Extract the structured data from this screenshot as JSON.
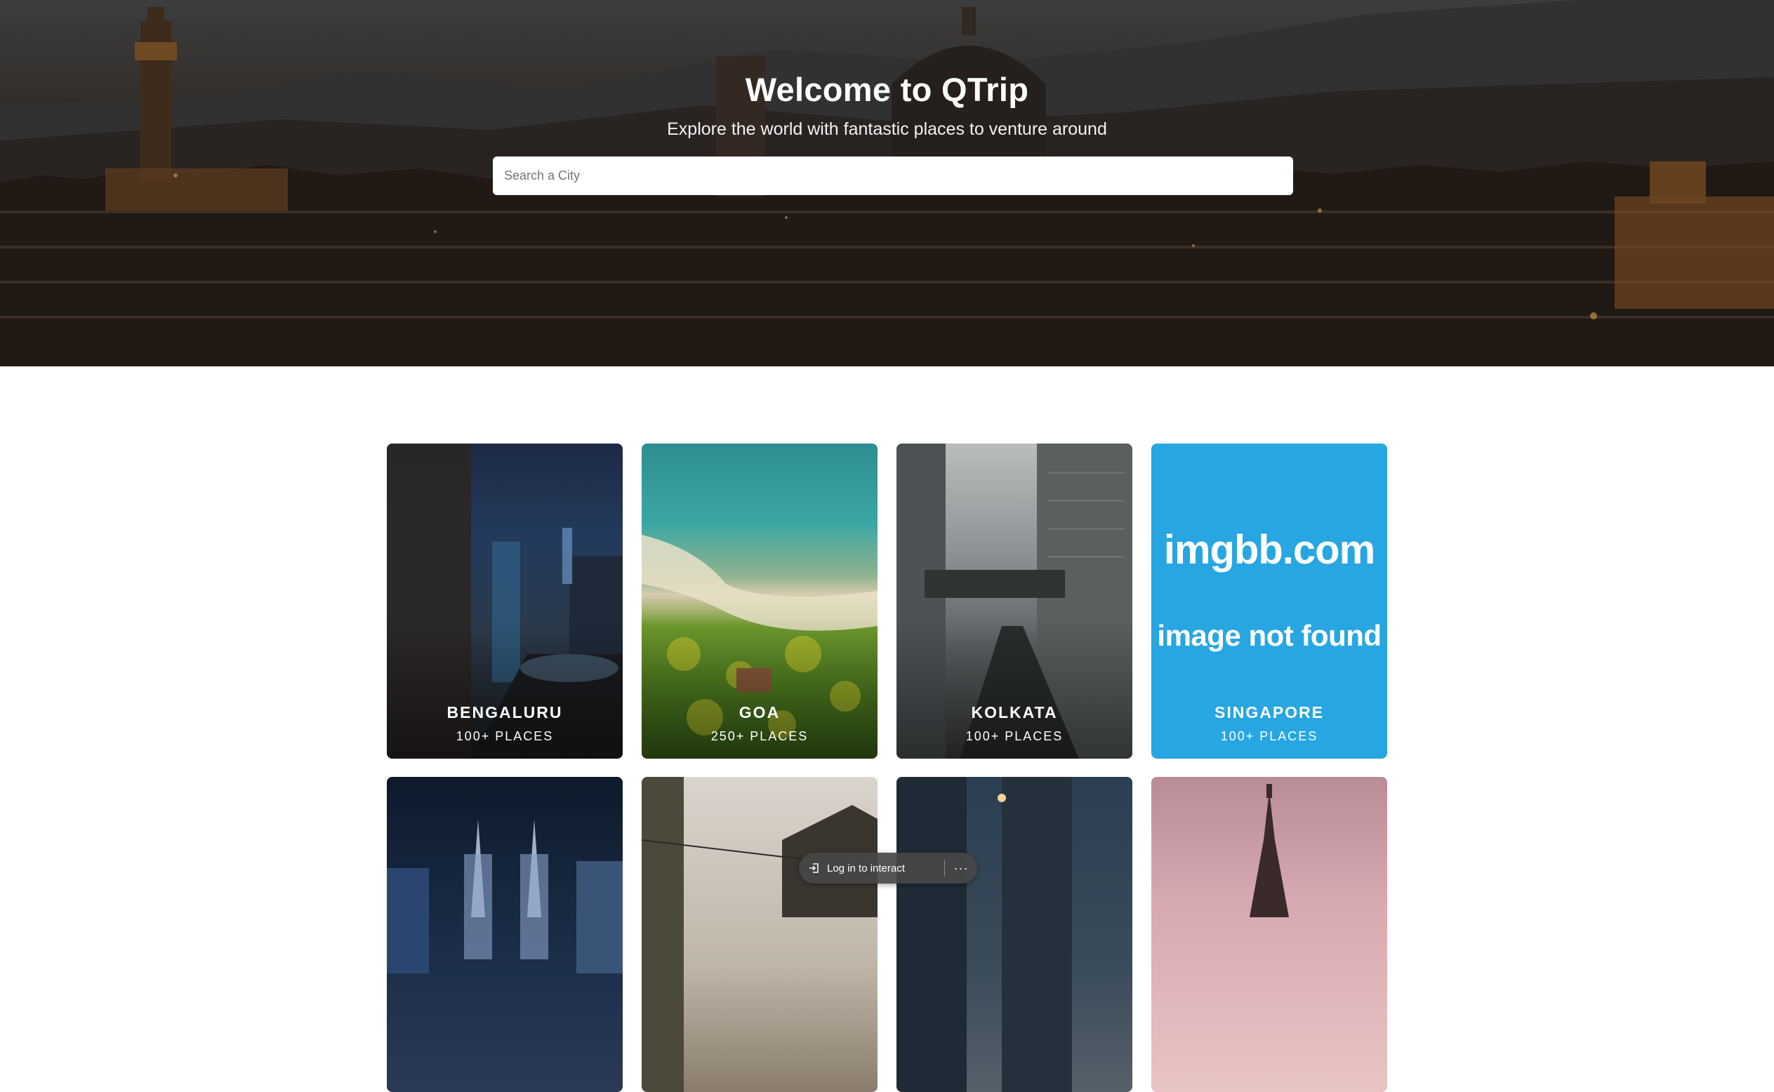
{
  "hero": {
    "title": "Welcome to QTrip",
    "subtitle": "Explore the world with fantastic places to venture around",
    "search_placeholder": "Search a City"
  },
  "cities": [
    {
      "name": "Bengaluru",
      "places": "100+ Places"
    },
    {
      "name": "Goa",
      "places": "250+ Places"
    },
    {
      "name": "Kolkata",
      "places": "100+ Places"
    },
    {
      "name": "Singapore",
      "places": "100+ Places",
      "image_text_top": "imgbb.com",
      "image_text_bottom": "image not found"
    },
    {
      "name": "",
      "places": ""
    },
    {
      "name": "",
      "places": ""
    },
    {
      "name": "",
      "places": ""
    },
    {
      "name": "",
      "places": ""
    }
  ],
  "overlay": {
    "login_label": "Log in to interact",
    "login_icon": "login-icon",
    "more_label": "···"
  },
  "colors": {
    "search_bg": "#ffffff",
    "singapore_placeholder_bg": "#27a6e2",
    "pill_bg": "#464646"
  }
}
